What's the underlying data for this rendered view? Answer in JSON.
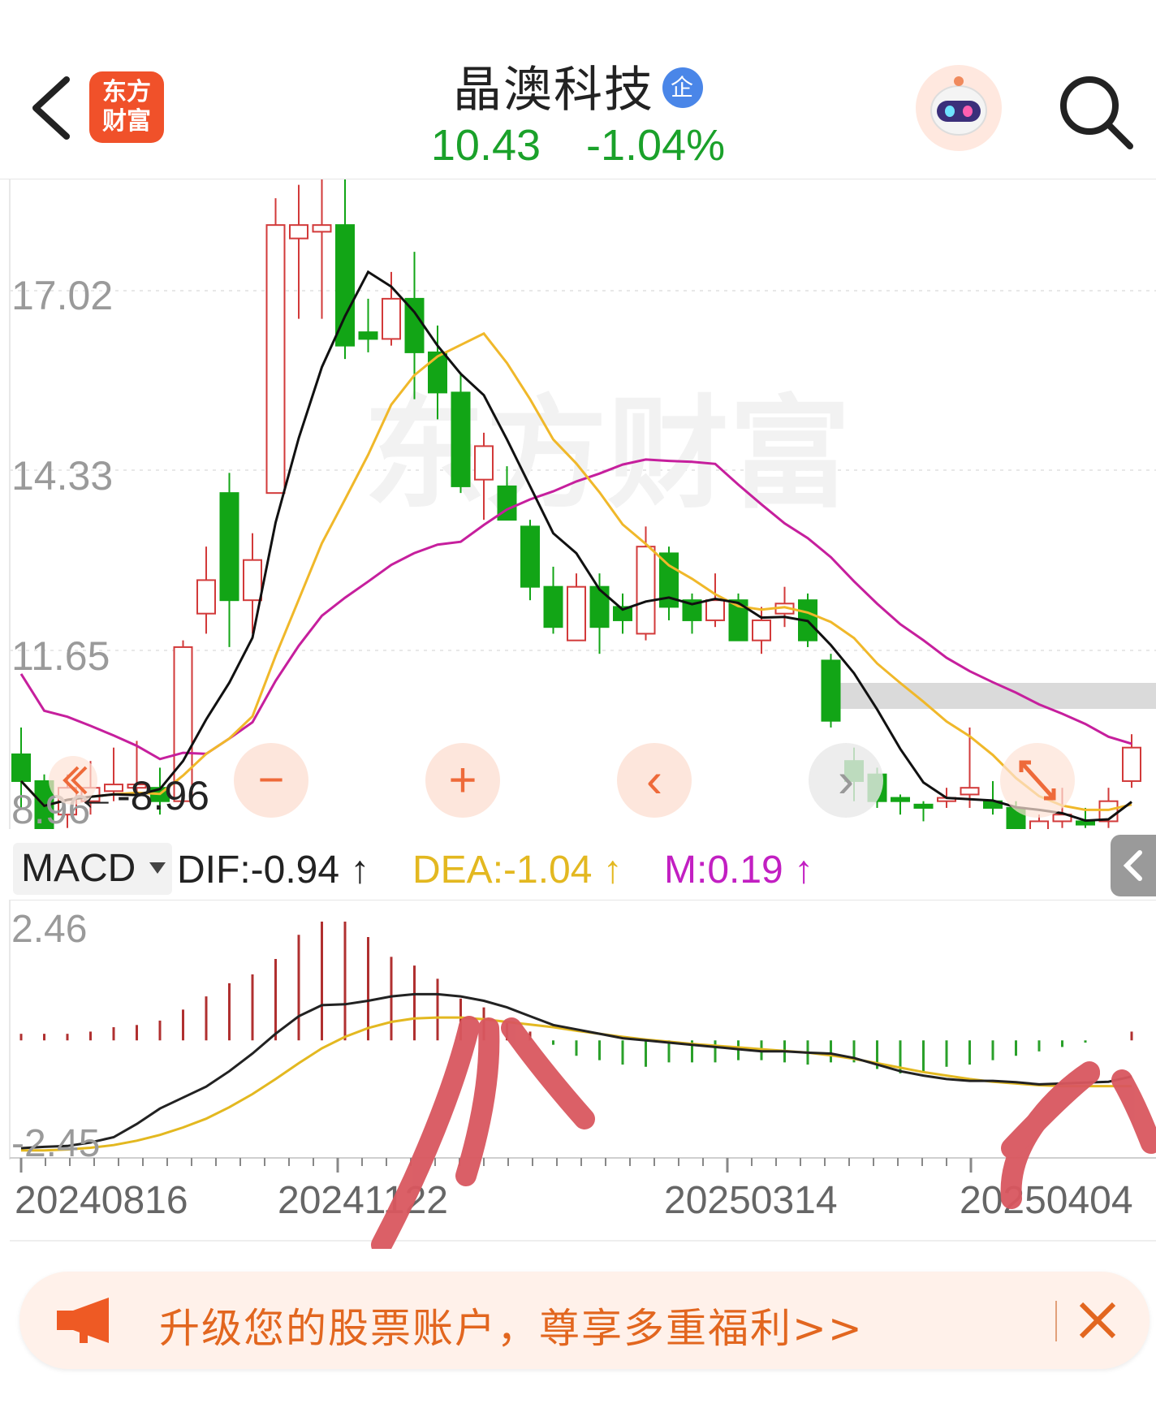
{
  "header": {
    "logo_line1": "东方",
    "logo_line2": "财富",
    "stock_name": "晶澳科技",
    "badge": "企",
    "price": "10.43",
    "change_pct": "-1.04%"
  },
  "main_chart": {
    "y_labels": [
      "17.02",
      "14.33",
      "11.65",
      "8.96"
    ],
    "low_marker": "←-8.96",
    "watermark": "东方财富",
    "zoom_out": "−",
    "zoom_in": "+",
    "nav_left": "‹",
    "nav_right": "›",
    "colors": {
      "up": "#d23a3a",
      "down": "#12a516",
      "ma5": "#111111",
      "ma10": "#f0b82a",
      "ma20": "#c61f9d"
    }
  },
  "macd": {
    "selector": "MACD",
    "dif": "DIF:-0.94",
    "dea": "DEA:-1.04",
    "m": "M:0.19",
    "up_arrow": "↑",
    "y_top": "2.46",
    "y_bottom": "-2.45",
    "x_labels": [
      "20240816",
      "20241122",
      "20250314",
      "20250404"
    ],
    "colors": {
      "dif": "#222222",
      "dea": "#e3b820",
      "m": "#c21fc2"
    }
  },
  "banner": {
    "text": "升级您的股票账户，尊享多重福利>>",
    "close": "×"
  }
}
